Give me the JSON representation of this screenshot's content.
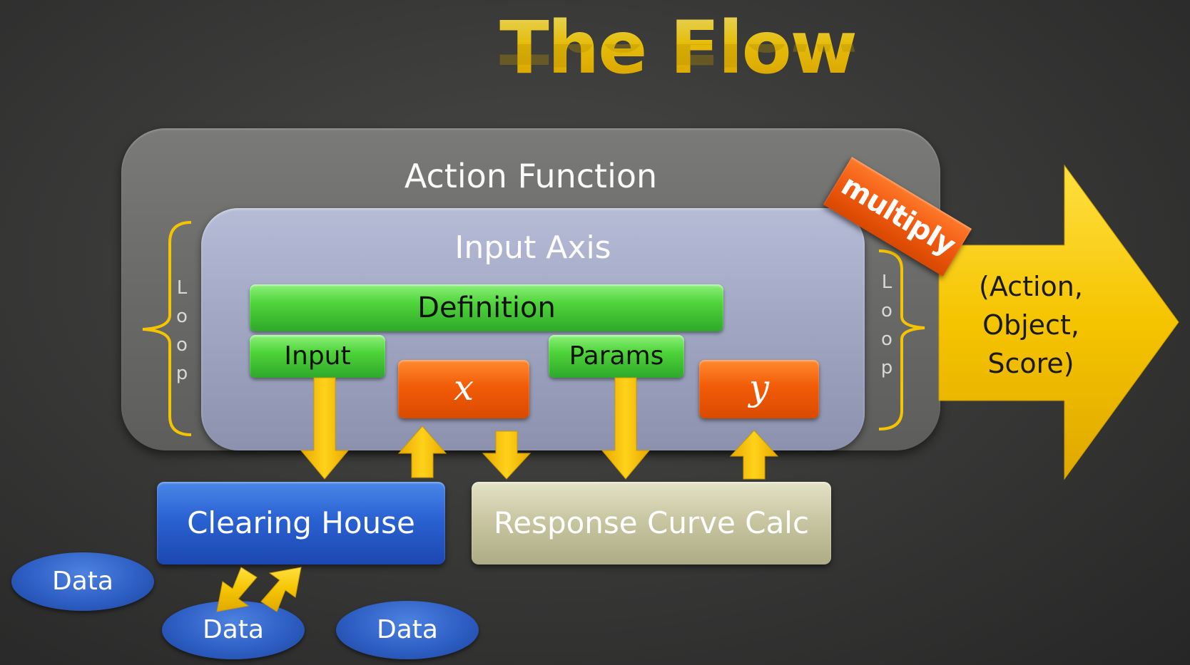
{
  "title": "The Flow",
  "action_function": {
    "label": "Action Function"
  },
  "input_axis": {
    "label": "Input Axis"
  },
  "definition": {
    "label": "Definition"
  },
  "input": {
    "label": "Input"
  },
  "params": {
    "label": "Params"
  },
  "x_var": {
    "label": "x"
  },
  "y_var": {
    "label": "y"
  },
  "clearing_house": {
    "label": "Clearing House"
  },
  "response_curve": {
    "label": "Response Curve Calc"
  },
  "data_nodes": [
    "Data",
    "Data",
    "Data"
  ],
  "loop_letters": [
    "L",
    "o",
    "o",
    "p"
  ],
  "multiply": {
    "label": "multiply"
  },
  "result": {
    "lines": [
      "(Action,",
      "Object,",
      "Score)"
    ]
  },
  "colors": {
    "title_gold": "#ffd20a",
    "arrow_gold": "#f5c400",
    "green": "#4fd43a",
    "orange": "#f25c08",
    "blue": "#2a62d2",
    "khaki": "#c9c7a2"
  }
}
